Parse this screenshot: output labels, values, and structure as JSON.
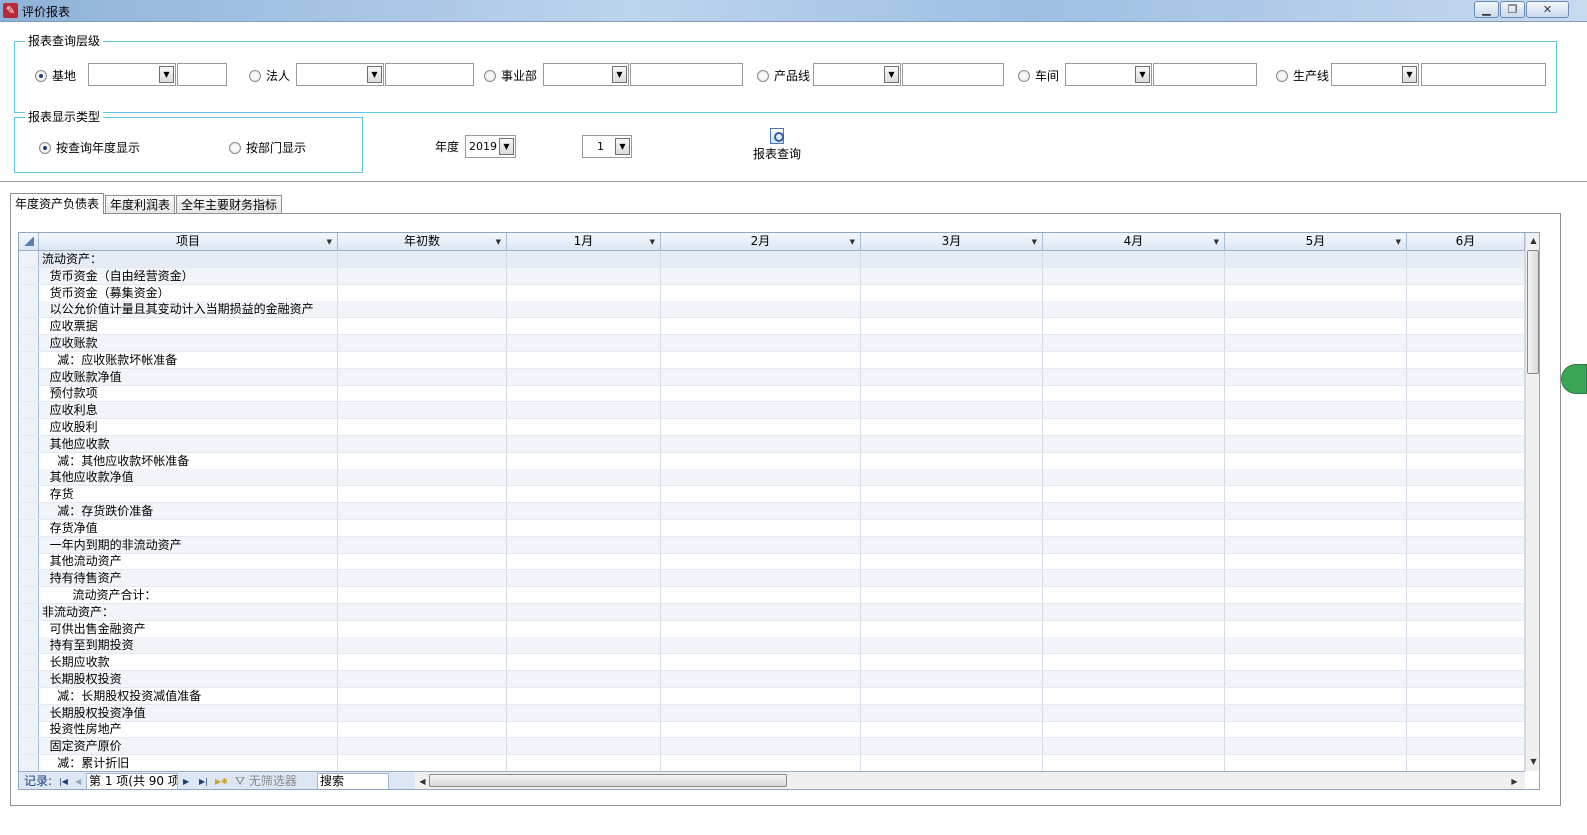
{
  "window": {
    "title": "评价报表"
  },
  "query_level": {
    "legend": "报表查询层级",
    "options": [
      {
        "label": "基地",
        "checked": true
      },
      {
        "label": "法人",
        "checked": false
      },
      {
        "label": "事业部",
        "checked": false
      },
      {
        "label": "产品线",
        "checked": false
      },
      {
        "label": "车间",
        "checked": false
      },
      {
        "label": "生产线",
        "checked": false
      }
    ]
  },
  "display_type": {
    "legend": "报表显示类型",
    "options": [
      {
        "label": "按查询年度显示",
        "checked": true
      },
      {
        "label": "按部门显示",
        "checked": false
      }
    ]
  },
  "year": {
    "label": "年度",
    "value": "2019"
  },
  "period": {
    "value": "1"
  },
  "query_button": {
    "label": "报表查询"
  },
  "tabs": [
    {
      "label": "年度资产负债表",
      "active": true
    },
    {
      "label": "年度利润表",
      "active": false
    },
    {
      "label": "全年主要财务指标",
      "active": false
    }
  ],
  "grid": {
    "columns": [
      "项目",
      "年初数",
      "1月",
      "2月",
      "3月",
      "4月",
      "5月",
      "6月"
    ],
    "rows": [
      "流动资产：",
      "  货币资金（自由经营资金）",
      "  货币资金（募集资金）",
      "  以公允价值计量且其变动计入当期损益的金融资产",
      "  应收票据",
      "  应收账款",
      "    减：应收账款坏帐准备",
      "  应收账款净值",
      "  预付款项",
      "  应收利息",
      "  应收股利",
      "  其他应收款",
      "    减：其他应收款坏帐准备",
      "  其他应收款净值",
      "  存货",
      "    减：存货跌价准备",
      "  存货净值",
      "  一年内到期的非流动资产",
      "  其他流动资产",
      "  持有待售资产",
      "        流动资产合计：",
      "非流动资产：",
      "  可供出售金融资产",
      "  持有至到期投资",
      "  长期应收款",
      "  长期股权投资",
      "    减：长期股权投资减值准备",
      "  长期股权投资净值",
      "  投资性房地产",
      "  固定资产原价",
      "    减：累计折旧"
    ]
  },
  "navigation": {
    "record_label": "记录:",
    "record_position": "第 1 项(共 90 项",
    "filter_label": "无筛选器",
    "search_label": "搜索"
  }
}
